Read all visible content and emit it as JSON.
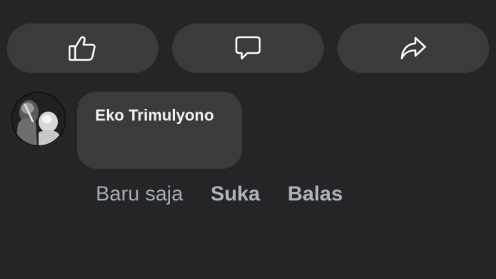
{
  "actions": {
    "like_icon": "thumbs-up-icon",
    "comment_icon": "speech-bubble-icon",
    "share_icon": "share-arrow-icon"
  },
  "comment": {
    "author": "Eko Trimulyono",
    "time": "Baru saja",
    "like_label": "Suka",
    "reply_label": "Balas"
  },
  "colors": {
    "background": "#242527",
    "surface": "#3a3b3c",
    "text_primary": "#f2f3f5",
    "text_secondary": "#a8abaf"
  }
}
